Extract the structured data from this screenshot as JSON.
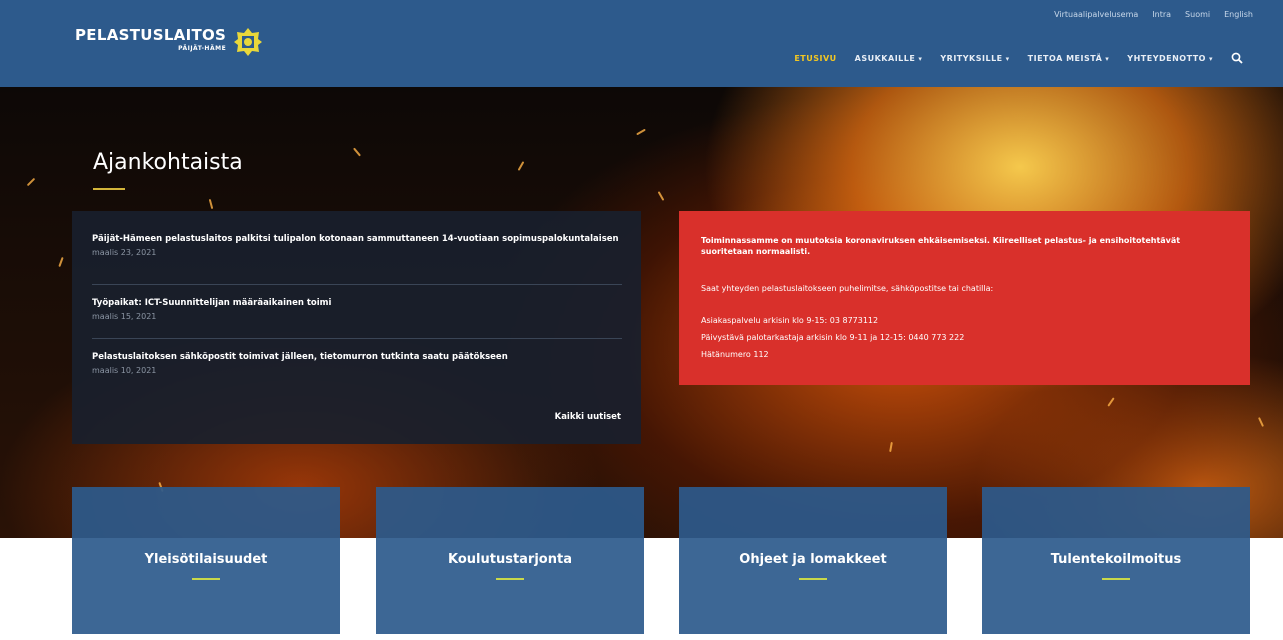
{
  "header": {
    "top_links": [
      "Virtuaalipalvelusema",
      "Intra",
      "Suomi",
      "English"
    ],
    "logo": {
      "name": "PELASTUSLAITOS",
      "sub": "PÄIJÄT-HÄME"
    },
    "nav": [
      {
        "label": "ETUSIVU",
        "active": true,
        "dropdown": false
      },
      {
        "label": "ASUKKAILLE",
        "active": false,
        "dropdown": true
      },
      {
        "label": "YRITYKSILLE",
        "active": false,
        "dropdown": true
      },
      {
        "label": "TIETOA MEISTÄ",
        "active": false,
        "dropdown": true
      },
      {
        "label": "YHTEYDENOTTO",
        "active": false,
        "dropdown": true
      }
    ],
    "search_icon": "search-icon"
  },
  "hero": {
    "title": "Ajankohtaista"
  },
  "news": {
    "items": [
      {
        "title": "Päijät-Hämeen pelastuslaitos palkitsi tulipalon kotonaan sammuttaneen 14-vuotiaan sopimuspalokuntalaisen",
        "date": "maalis 23, 2021"
      },
      {
        "title": "Työpaikat: ICT-Suunnittelijan määräaikainen toimi",
        "date": "maalis 15, 2021"
      },
      {
        "title": "Pelastuslaitoksen sähköpostit toimivat jälleen, tietomurron tutkinta saatu päätökseen",
        "date": "maalis 10, 2021"
      }
    ],
    "all_label": "Kaikki uutiset"
  },
  "alert": {
    "bold_text": "Toiminnassamme on muutoksia koronaviruksen ehkäisemiseksi. Kiireelliset pelastus- ja ensihoitotehtävät suoritetaan normaalisti.",
    "contact_intro": "Saat yhteyden pelastuslaitokseen puhelimitse, sähköpostitse tai chatilla:",
    "line1": "Asiakaspalvelu arkisin klo 9-15: 03 8773112",
    "line2": "Päivystävä palotarkastaja arkisin klo 9-11 ja 12-15: 0440 773 222",
    "line3": "Hätänumero 112"
  },
  "cards": [
    {
      "label": "Yleisötilaisuudet"
    },
    {
      "label": "Koulutustarjonta"
    },
    {
      "label": "Ohjeet ja lomakkeet"
    },
    {
      "label": "Tulentekoilmoitus"
    }
  ],
  "colors": {
    "header": "#2d5a8c",
    "accent": "#f3c722",
    "alert": "#d9302b",
    "card": "#2d5a8c"
  }
}
